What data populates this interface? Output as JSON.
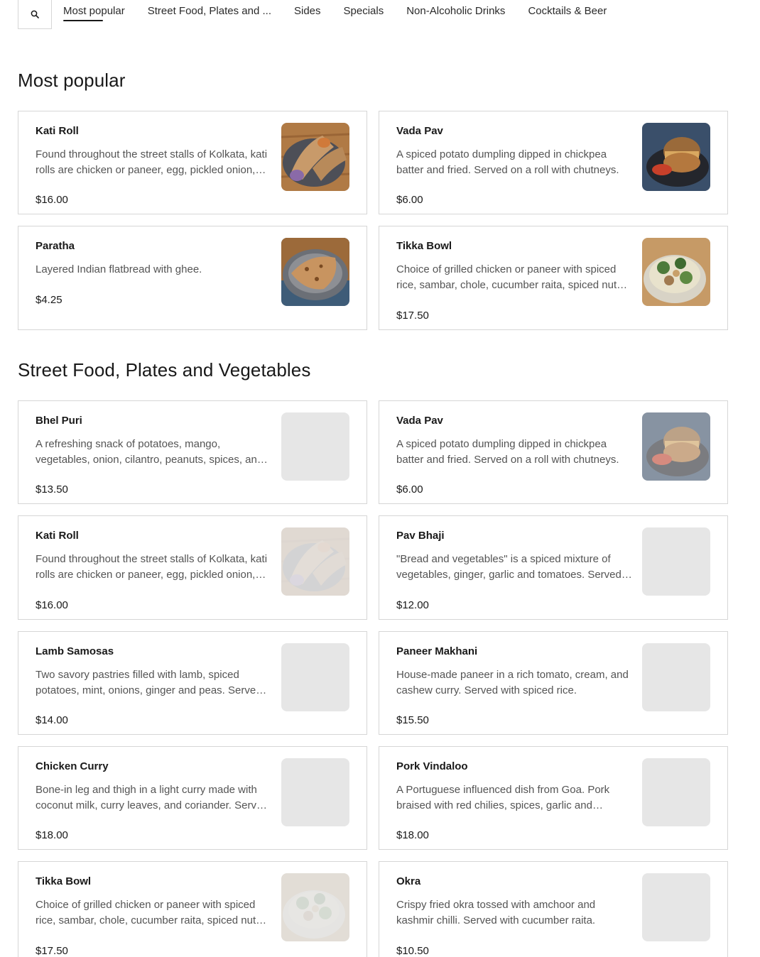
{
  "nav": {
    "search_icon": "search-icon",
    "tabs": [
      {
        "label": "Most popular",
        "active": true
      },
      {
        "label": "Street Food, Plates and ..."
      },
      {
        "label": "Sides"
      },
      {
        "label": "Specials"
      },
      {
        "label": "Non-Alcoholic Drinks"
      },
      {
        "label": "Cocktails & Beer"
      }
    ]
  },
  "sections": [
    {
      "title": "Most popular",
      "items": [
        {
          "name": "Kati Roll",
          "description": "Found throughout the street stalls of Kolkata, kati rolls are chicken or paneer, egg, pickled onion, cilantro and chutney wrapped in paratha.",
          "price": "$16.00",
          "image": "kati-roll-photo"
        },
        {
          "name": "Vada Pav",
          "description": "A spiced potato dumpling dipped in chickpea batter and fried. Served on a roll with chutneys.",
          "price": "$6.00",
          "image": "vada-pav-photo"
        },
        {
          "name": "Paratha",
          "description": "Layered Indian flatbread with ghee.",
          "price": "$4.25",
          "image": "paratha-photo"
        },
        {
          "name": "Tikka Bowl",
          "description": "Choice of grilled chicken or paneer with spiced rice, sambar, chole, cucumber raita, spiced nuts and greens.",
          "price": "$17.50",
          "image": "tikka-bowl-photo"
        }
      ]
    },
    {
      "title": "Street Food, Plates and Vegetables",
      "items": [
        {
          "name": "Bhel Puri",
          "description": "A refreshing snack of potatoes, mango, vegetables, onion, cilantro, peanuts, spices, and chutneys.",
          "price": "$13.50",
          "image": "placeholder"
        },
        {
          "name": "Vada Pav",
          "description": "A spiced potato dumpling dipped in chickpea batter and fried. Served on a roll with chutneys.",
          "price": "$6.00",
          "image": "vada-pav-photo-loading"
        },
        {
          "name": "Kati Roll",
          "description": "Found throughout the street stalls of Kolkata, kati rolls are chicken or paneer, egg, pickled onion, cilantro and chutney wrapped in paratha.",
          "price": "$16.00",
          "image": "kati-roll-photo-loading"
        },
        {
          "name": "Pav Bhaji",
          "description": "\"Bread and vegetables\" is a spiced mixture of vegetables, ginger, garlic and tomatoes. Served with buttered rolls.",
          "price": "$12.00",
          "image": "placeholder"
        },
        {
          "name": "Lamb Samosas",
          "description": "Two savory pastries filled with lamb, spiced potatoes, mint, onions, ginger and peas. Served with chutneys.",
          "price": "$14.00",
          "image": "placeholder"
        },
        {
          "name": "Paneer Makhani",
          "description": "House-made paneer in a rich tomato, cream, and cashew curry. Served with spiced rice.",
          "price": "$15.50",
          "image": "placeholder"
        },
        {
          "name": "Chicken Curry",
          "description": "Bone-in leg and thigh in a light curry made with coconut milk, curry leaves, and coriander. Served with spiced rice.",
          "price": "$18.00",
          "image": "placeholder"
        },
        {
          "name": "Pork Vindaloo",
          "description": "A Portuguese influenced dish from Goa. Pork braised with red chilies, spices, garlic and vinegar.",
          "price": "$18.00",
          "image": "placeholder"
        },
        {
          "name": "Tikka Bowl",
          "description": "Choice of grilled chicken or paneer with spiced rice, sambar, chole, cucumber raita, spiced nuts and greens.",
          "price": "$17.50",
          "image": "tikka-bowl-photo-loading"
        },
        {
          "name": "Okra",
          "description": "Crispy fried okra tossed with amchoor and kashmir chilli. Served with cucumber raita.",
          "price": "$10.50",
          "image": "placeholder"
        }
      ]
    }
  ]
}
